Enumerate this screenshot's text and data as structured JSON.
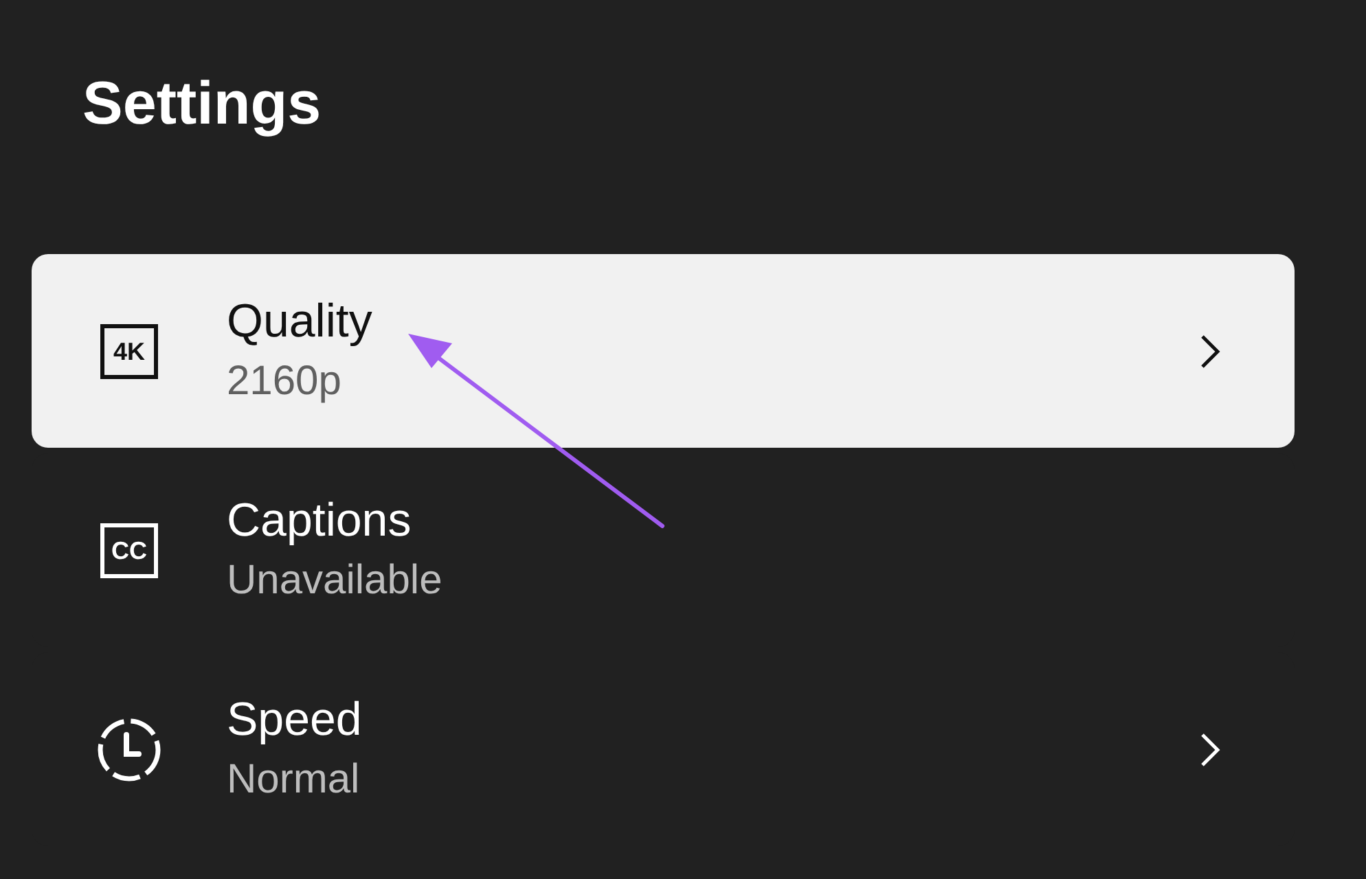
{
  "title": "Settings",
  "items": [
    {
      "kind": "badge",
      "icon_text": "4K",
      "label": "Quality",
      "value": "2160p",
      "selected": true,
      "chevron": true
    },
    {
      "kind": "badge",
      "icon_text": "CC",
      "label": "Captions",
      "value": "Unavailable",
      "selected": false,
      "chevron": false
    },
    {
      "kind": "clock",
      "label": "Speed",
      "value": "Normal",
      "selected": false,
      "chevron": true
    }
  ]
}
